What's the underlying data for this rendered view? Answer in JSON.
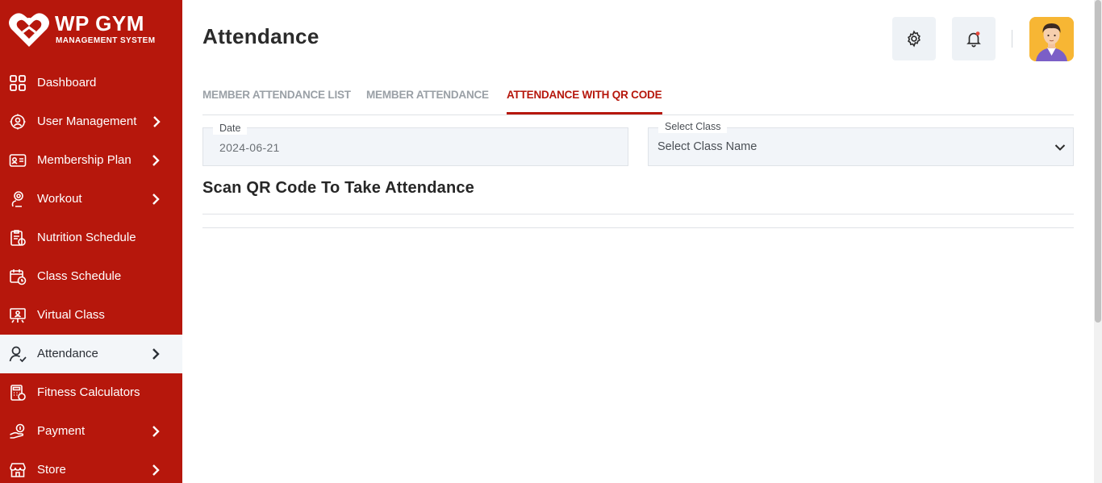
{
  "brand": {
    "title": "WP GYM",
    "subtitle": "MANAGEMENT SYSTEM",
    "logo_icon": "heart-gym-logo",
    "primary_color": "#b6170c"
  },
  "sidebar": {
    "items": [
      {
        "label": "Dashboard",
        "icon": "dashboard-grid-icon",
        "has_submenu": false
      },
      {
        "label": "User Management",
        "icon": "users-gear-icon",
        "has_submenu": true
      },
      {
        "label": "Membership Plan",
        "icon": "membership-card-icon",
        "has_submenu": true
      },
      {
        "label": "Workout",
        "icon": "workout-icon",
        "has_submenu": true
      },
      {
        "label": "Nutrition Schedule",
        "icon": "nutrition-clipboard-icon",
        "has_submenu": false
      },
      {
        "label": "Class Schedule",
        "icon": "calendar-clock-icon",
        "has_submenu": false
      },
      {
        "label": "Virtual Class",
        "icon": "virtual-class-icon",
        "has_submenu": false
      },
      {
        "label": "Attendance",
        "icon": "user-check-icon",
        "has_submenu": true,
        "active": true
      },
      {
        "label": "Fitness Calculators",
        "icon": "calculator-icon",
        "has_submenu": false
      },
      {
        "label": "Payment",
        "icon": "payment-hand-icon",
        "has_submenu": true
      },
      {
        "label": "Store",
        "icon": "store-icon",
        "has_submenu": true
      }
    ]
  },
  "header": {
    "title": "Attendance",
    "settings_icon": "gear-icon",
    "notifications_icon": "bell-icon",
    "avatar_icon": "user-avatar"
  },
  "tabs": [
    {
      "label": "MEMBER ATTENDANCE LIST",
      "active": false
    },
    {
      "label": "MEMBER ATTENDANCE",
      "active": false
    },
    {
      "label": "ATTENDANCE WITH QR CODE",
      "active": true
    }
  ],
  "form": {
    "date": {
      "label": "Date",
      "value": "2024-06-21"
    },
    "class_select": {
      "label": "Select Class",
      "selected": "Select Class Name"
    }
  },
  "section": {
    "title": "Scan QR Code To Take Attendance"
  }
}
